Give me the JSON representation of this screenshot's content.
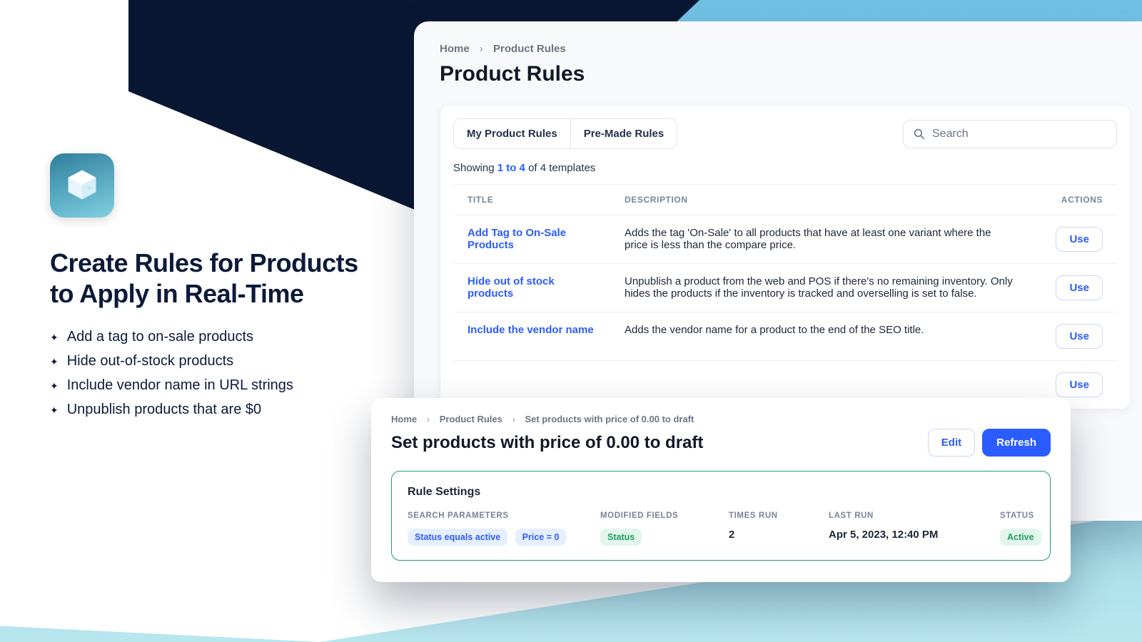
{
  "promo": {
    "headline_line1": "Create Rules for Products",
    "headline_line2": "to Apply in Real-Time",
    "bullets": [
      "Add a tag to on-sale products",
      "Hide out-of-stock products",
      "Include vendor name in URL strings",
      "Unpublish products that are $0"
    ]
  },
  "back": {
    "crumbs": {
      "home": "Home",
      "section": "Product Rules"
    },
    "title": "Product Rules",
    "tabs": {
      "my": "My Product Rules",
      "premade": "Pre-Made Rules"
    },
    "search_placeholder": "Search",
    "showing_prefix": "Showing ",
    "showing_range": "1 to 4",
    "showing_suffix": " of 4 templates",
    "cols": {
      "title": "TITLE",
      "desc": "DESCRIPTION",
      "actions": "ACTIONS"
    },
    "use_label": "Use",
    "rows": [
      {
        "title": "Add Tag to On-Sale Products",
        "desc": "Adds the tag 'On-Sale' to all products that have at least one variant where the price is less than the compare price."
      },
      {
        "title": "Hide out of stock products",
        "desc": "Unpublish a product from the web and POS if there's no remaining inventory. Only hides the products if the inventory is tracked and overselling is set to false."
      },
      {
        "title": "Include the vendor name",
        "desc": "Adds the vendor name for a product to the end of the SEO title."
      },
      {
        "title": "",
        "desc": ""
      }
    ]
  },
  "front": {
    "crumbs": {
      "home": "Home",
      "rules": "Product Rules",
      "current": "Set products with price of 0.00 to draft"
    },
    "title": "Set products with price of 0.00 to draft",
    "edit": "Edit",
    "refresh": "Refresh",
    "settings_title": "Rule Settings",
    "labels": {
      "search": "SEARCH PARAMETERS",
      "modified": "MODIFIED FIELDS",
      "times": "TIMES RUN",
      "last": "LAST RUN",
      "status": "STATUS"
    },
    "search_pills": [
      "Status equals active",
      "Price = 0"
    ],
    "modified_pill": "Status",
    "times_run": "2",
    "last_run": "Apr 5, 2023, 12:40 PM",
    "status": "Active"
  }
}
